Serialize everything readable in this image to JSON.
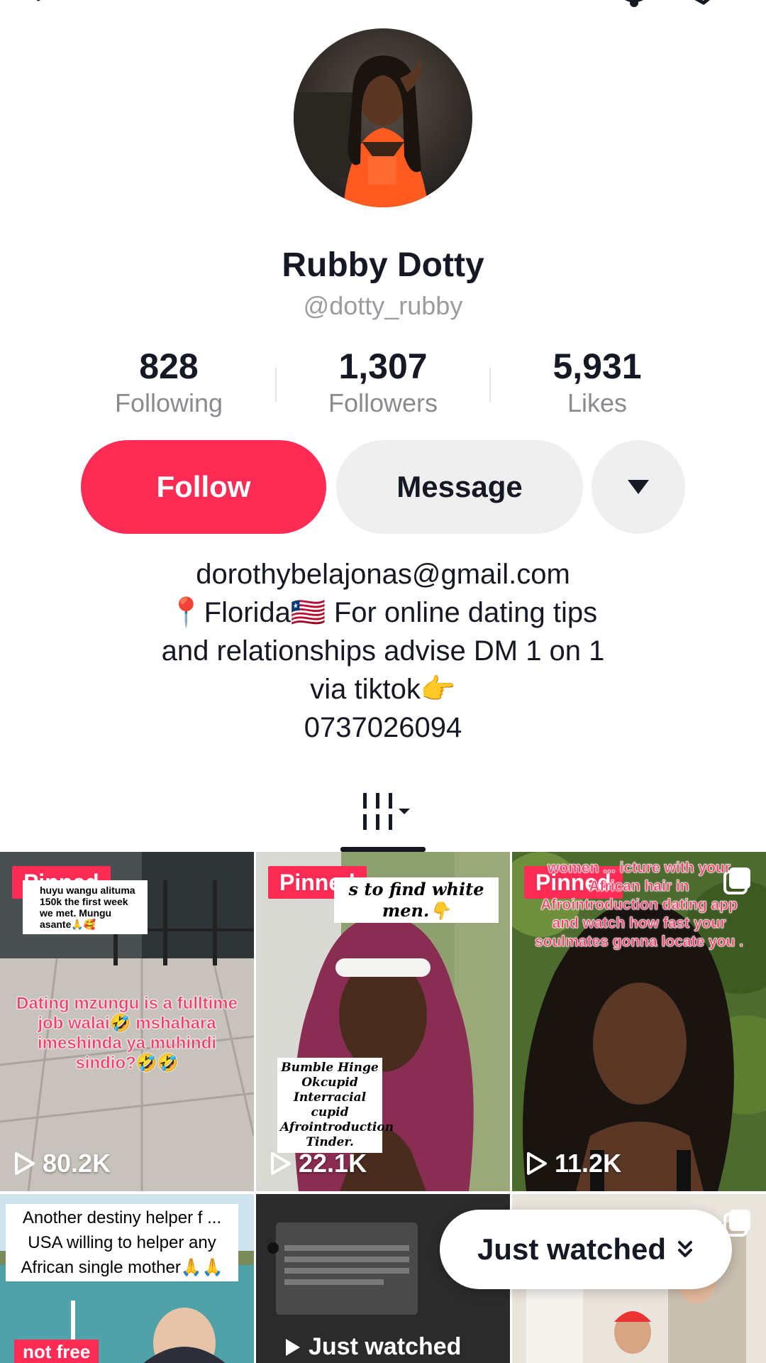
{
  "profile": {
    "display_name": "Rubby Dotty",
    "username": "@dotty_rubby"
  },
  "stats": [
    {
      "value": "828",
      "label": "Following"
    },
    {
      "value": "1,307",
      "label": "Followers"
    },
    {
      "value": "5,931",
      "label": "Likes"
    }
  ],
  "actions": {
    "follow_label": "Follow",
    "message_label": "Message"
  },
  "bio": {
    "line1": "dorothybelajonas@gmail.com",
    "line2": "📍Florida🇱🇷 For online dating tips",
    "line3": "and relationships advise DM 1 on 1",
    "line4": "via tiktok👉",
    "line5": "0737026094"
  },
  "videos": [
    {
      "pinned_label": "Pinned",
      "views": "80.2K",
      "comment_note": "huyu wangu alituma 150k the first week we met. Mungu asante🙏🥰",
      "caption": "Dating mzungu is a fulltime job walai🤣 mshahara imeshinda ya muhindi sindio?🤣🤣"
    },
    {
      "pinned_label": "Pinned",
      "views": "22.1K",
      "caption_top": "s to find white men.👇",
      "app_list": "Bumble Hinge Okcupid Interracial cupid Afrointroduction Tinder."
    },
    {
      "pinned_label": "Pinned",
      "views": "11.2K",
      "caption": "women ... icture with your African hair in Afrointroduction dating app and watch how fast your soulmates gonna locate you ."
    },
    {
      "caption": "Another destiny helper f ... USA willing to helper any African single mother🙏🙏",
      "tag": "not free"
    },
    {
      "overlay": "Just watched"
    },
    {}
  ],
  "just_watched_label": "Just watched",
  "colors": {
    "accent": "#fe2c55",
    "text": "#161823",
    "muted": "#8a8a8f",
    "button_gray": "#efefef"
  }
}
